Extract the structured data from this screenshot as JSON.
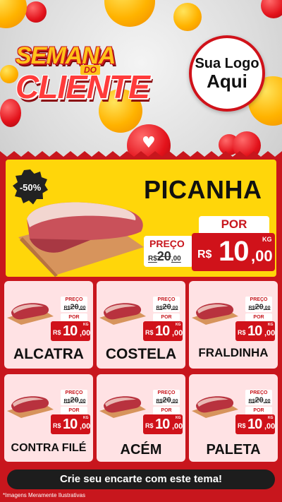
{
  "header": {
    "title_line1": "SEMANA",
    "title_do": "DO",
    "title_line2": "CLIENTE",
    "logo_line1": "Sua Logo",
    "logo_line2": "Aqui"
  },
  "featured": {
    "discount": "-50%",
    "name": "PICANHA",
    "por_label": "POR",
    "old_label": "PREÇO",
    "old_prefix": "R$",
    "old_int": "20",
    "old_cents": ",00",
    "new_prefix": "R$",
    "new_int": "10",
    "new_cents": ",00",
    "unit": "KG"
  },
  "products": [
    {
      "name": "ALCATRA",
      "preco_label": "PREÇO",
      "old_prefix": "R$",
      "old_int": "20",
      "old_cents": ",00",
      "por_label": "POR",
      "new_prefix": "R$",
      "new_int": "10",
      "new_cents": ",00",
      "unit": "KG"
    },
    {
      "name": "COSTELA",
      "preco_label": "PREÇO",
      "old_prefix": "R$",
      "old_int": "20",
      "old_cents": ",00",
      "por_label": "POR",
      "new_prefix": "R$",
      "new_int": "10",
      "new_cents": ",00",
      "unit": "KG"
    },
    {
      "name": "FRALDINHA",
      "preco_label": "PREÇO",
      "old_prefix": "R$",
      "old_int": "20",
      "old_cents": ",00",
      "por_label": "POR",
      "new_prefix": "R$",
      "new_int": "10",
      "new_cents": ",00",
      "unit": "KG"
    },
    {
      "name": "CONTRA FILÉ",
      "preco_label": "PREÇO",
      "old_prefix": "R$",
      "old_int": "20",
      "old_cents": ",00",
      "por_label": "POR",
      "new_prefix": "R$",
      "new_int": "10",
      "new_cents": ",00",
      "unit": "KG"
    },
    {
      "name": "ACÉM",
      "preco_label": "PREÇO",
      "old_prefix": "R$",
      "old_int": "20",
      "old_cents": ",00",
      "por_label": "POR",
      "new_prefix": "R$",
      "new_int": "10",
      "new_cents": ",00",
      "unit": "KG"
    },
    {
      "name": "PALETA",
      "preco_label": "PREÇO",
      "old_prefix": "R$",
      "old_int": "20",
      "old_cents": ",00",
      "por_label": "POR",
      "new_prefix": "R$",
      "new_int": "10",
      "new_cents": ",00",
      "unit": "KG"
    }
  ],
  "cta": "Crie seu encarte com este tema!",
  "disclaimer": "*Imagens Meramente Ilustrativas",
  "colors": {
    "red": "#d0121a",
    "yellow": "#ffd60a",
    "card_bg": "#ffe2e4",
    "dark": "#1d1d1d"
  },
  "icons": {
    "heart": "heart-icon",
    "emoji": "emoji-icon"
  }
}
